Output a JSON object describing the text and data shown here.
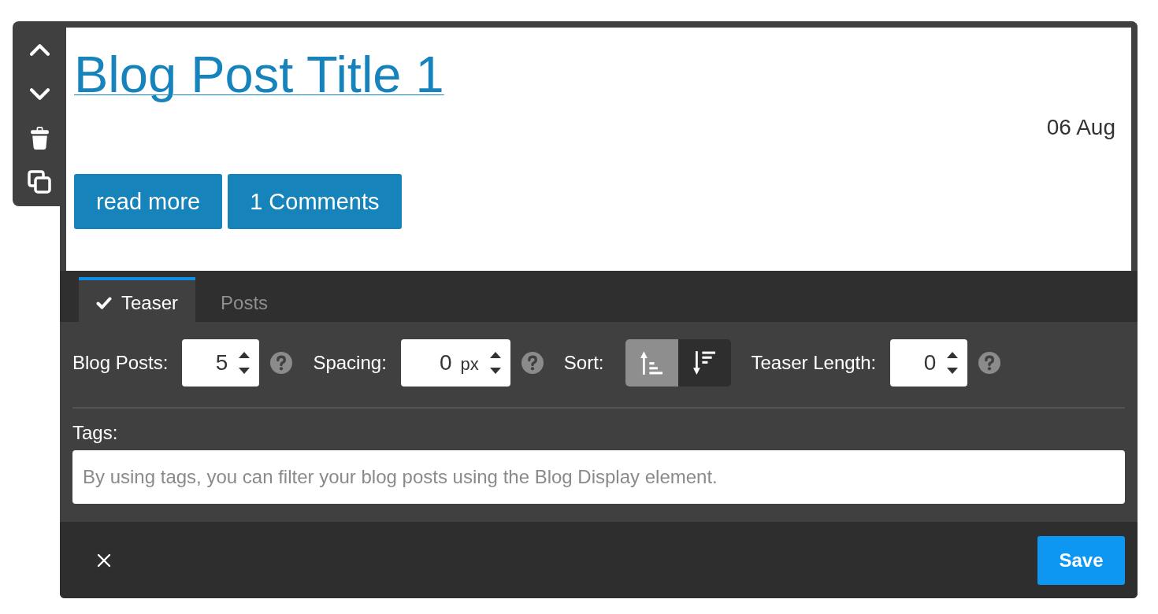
{
  "post": {
    "title": "Blog Post Title 1",
    "date": "06 Aug",
    "buttons": [
      "read more",
      "1 Comments"
    ]
  },
  "tabs": [
    {
      "label": "Teaser",
      "selected": true
    },
    {
      "label": "Posts",
      "selected": false
    }
  ],
  "settings": [
    {
      "kind": "number",
      "label": "Blog Posts:",
      "value": "5",
      "help": true
    },
    {
      "kind": "number",
      "label": "Spacing:",
      "value": "0",
      "unit": "px",
      "help": true
    },
    {
      "kind": "sort",
      "label": "Sort:",
      "options": [
        {
          "kind": "ascending",
          "selected": true
        },
        {
          "kind": "descending",
          "selected": false
        }
      ]
    },
    {
      "kind": "number",
      "label": "Teaser Length:",
      "value": "0",
      "help": true
    }
  ],
  "tags": {
    "label": "Tags:",
    "placeholder": "By using tags, you can filter your blog posts using the Blog Display element."
  },
  "footer": {
    "save": "Save"
  }
}
